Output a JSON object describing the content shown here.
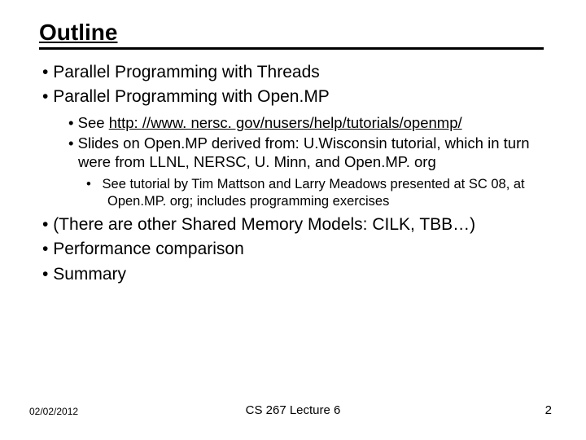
{
  "title": "Outline",
  "b1": "Parallel Programming with Threads",
  "b2": "Parallel Programming with Open.MP",
  "b2_1_pre": "See ",
  "b2_1_link": "http: //www. nersc. gov/nusers/help/tutorials/openmp/",
  "b2_2": "Slides on Open.MP derived from: U.Wisconsin tutorial, which in turn were from LLNL, NERSC, U. Minn, and Open.MP. org",
  "b2_2_1": "See tutorial by Tim Mattson and Larry Meadows presented at SC 08, at Open.MP. org; includes programming exercises",
  "b3": "(There are other Shared Memory Models: CILK, TBB…)",
  "b4": "Performance comparison",
  "b5": "Summary",
  "footer_date": "02/02/2012",
  "footer_center": "CS 267 Lecture 6",
  "footer_num": "2"
}
